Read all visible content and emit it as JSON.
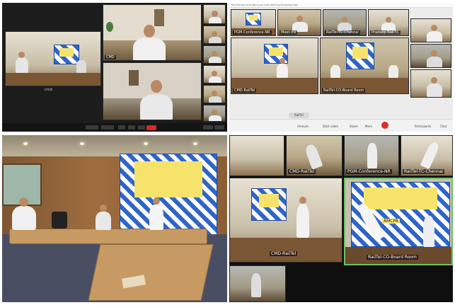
{
  "panel1": {
    "tiles": [
      {
        "label": ""
      },
      {
        "label": "CMD"
      },
      {
        "label": ""
      },
      {
        "label": ""
      }
    ],
    "footer_caption": "cmd"
  },
  "panel2": {
    "menu": "File  Edit  View  Tools  Tabs  Audio  Video  Participants  Meeting  Help",
    "tiles": [
      {
        "label": "PGM-Conference-NR"
      },
      {
        "label": "Meet-Ins"
      },
      {
        "label": "RailTel-TC-Chennai"
      },
      {
        "label": "Pradeep-Rail-TC"
      },
      {
        "label": "CMD-RailTel"
      },
      {
        "label": "RailTel-CO-Board Room"
      }
    ],
    "toolbar": {
      "unmute": "Unmute",
      "start_video": "Start video",
      "share": "Share",
      "more": "More",
      "participants": "Participants",
      "chat": "Chat"
    },
    "status_pill": "RailTel"
  },
  "panel4": {
    "labels": [
      {
        "text": "CMD-RailTel"
      },
      {
        "text": "PGM-Conference-NR"
      },
      {
        "text": "RailTel-TC-Chennai"
      },
      {
        "text": "CMD-RailTel"
      },
      {
        "text": "RailTel-CO-Board Room"
      }
    ],
    "banner_text": "AMCPA"
  },
  "colors": {
    "banner_blue": "#2f64c8",
    "banner_yellow": "#f6e36b",
    "leave_red": "#d9312b"
  }
}
